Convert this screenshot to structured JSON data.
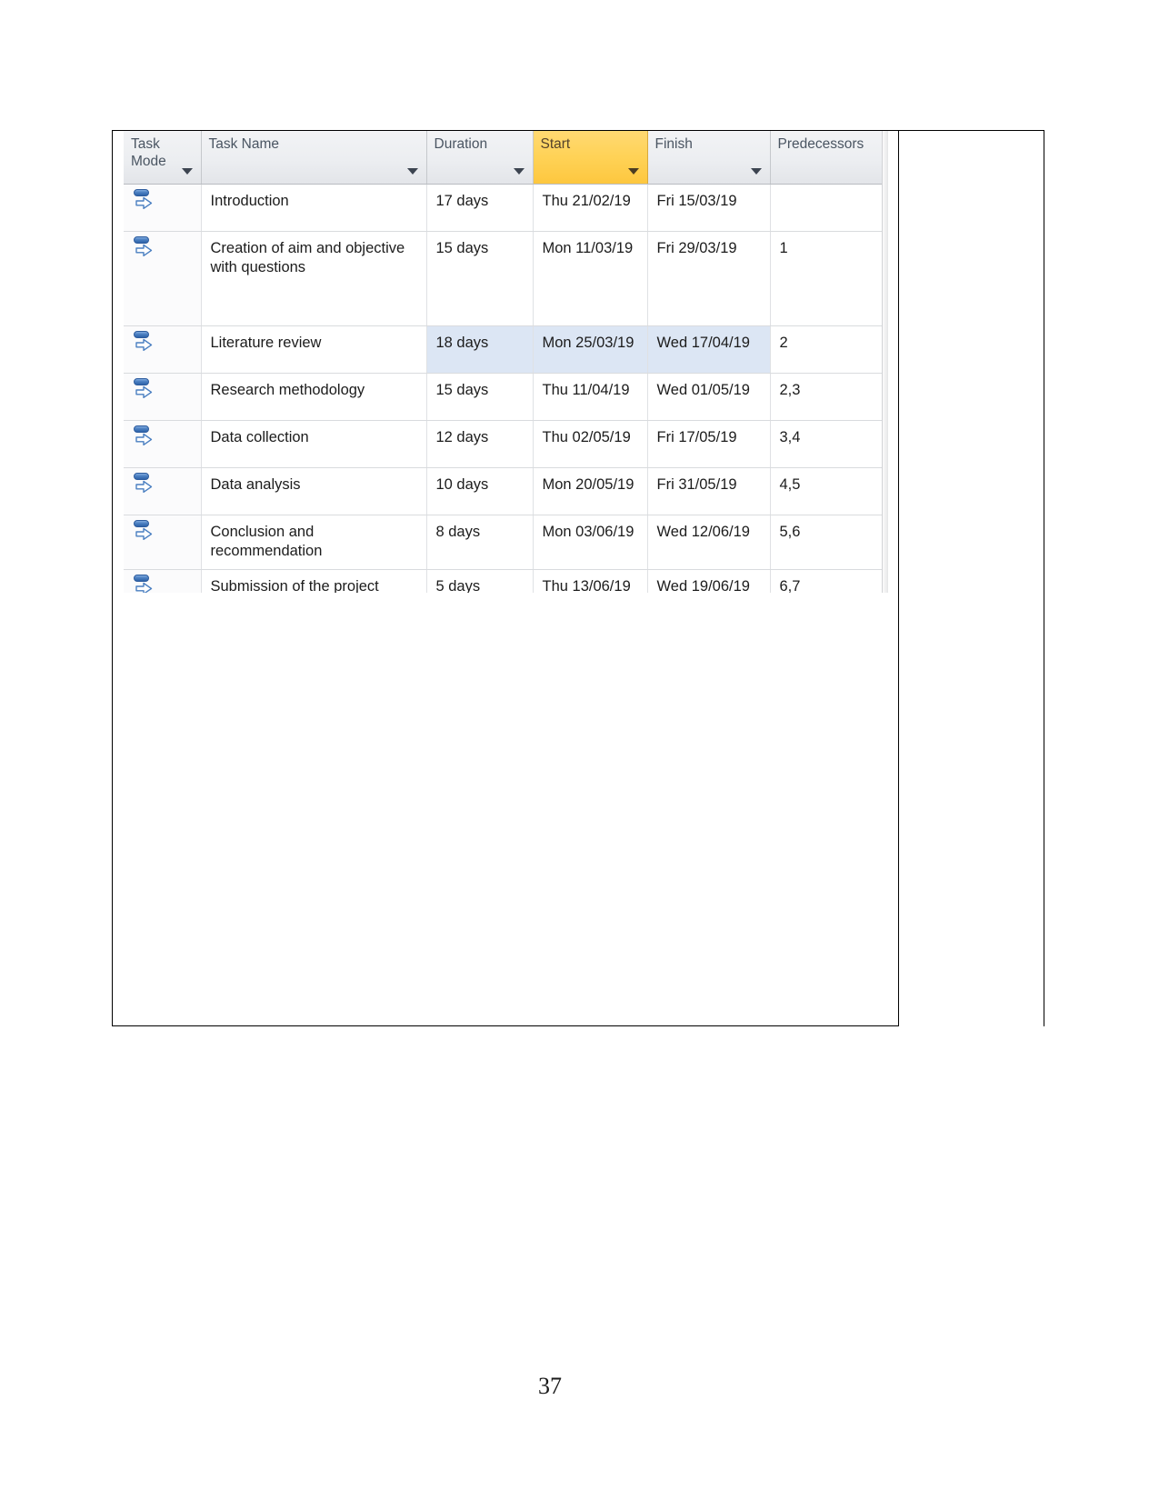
{
  "page": {
    "page_number": "37"
  },
  "project_table": {
    "columns": [
      {
        "id": "task_mode",
        "label": "Task Mode",
        "has_filter_caret": true,
        "highlighted": false
      },
      {
        "id": "task_name",
        "label": "Task Name",
        "has_filter_caret": true,
        "highlighted": false
      },
      {
        "id": "duration",
        "label": "Duration",
        "has_filter_caret": true,
        "highlighted": false
      },
      {
        "id": "start",
        "label": "Start",
        "has_filter_caret": true,
        "highlighted": true
      },
      {
        "id": "finish",
        "label": "Finish",
        "has_filter_caret": true,
        "highlighted": false
      },
      {
        "id": "predecessors",
        "label": "Predecessors",
        "has_filter_caret": false,
        "highlighted": false
      }
    ],
    "colors": {
      "header_background": "#eceef1",
      "header_text": "#4a5562",
      "start_header_background": "#ffd256",
      "start_header_text": "#53422a",
      "selection_background": "#dce6f4",
      "grid_line": "#d9dbde",
      "task_mode_icon": "#2f63a8"
    },
    "rows": [
      {
        "task_mode_icon": "manually-scheduled-icon",
        "task_name": "Introduction",
        "duration": "17 days",
        "start": "Thu 21/02/19",
        "finish": "Fri 15/03/19",
        "predecessors": "",
        "selected": false
      },
      {
        "task_mode_icon": "manually-scheduled-icon",
        "task_name": "Creation of aim and objective with questions",
        "duration": "15 days",
        "start": "Mon 11/03/19",
        "finish": "Fri 29/03/19",
        "predecessors": "1",
        "selected": false
      },
      {
        "task_mode_icon": "manually-scheduled-icon",
        "task_name": "Literature review",
        "duration": "18 days",
        "start": "Mon 25/03/19",
        "finish": "Wed 17/04/19",
        "predecessors": "2",
        "selected": true
      },
      {
        "task_mode_icon": "manually-scheduled-icon",
        "task_name": "Research methodology",
        "duration": "15 days",
        "start": "Thu 11/04/19",
        "finish": "Wed 01/05/19",
        "predecessors": "2,3",
        "selected": false
      },
      {
        "task_mode_icon": "manually-scheduled-icon",
        "task_name": "Data collection",
        "duration": "12 days",
        "start": "Thu 02/05/19",
        "finish": "Fri 17/05/19",
        "predecessors": "3,4",
        "selected": false
      },
      {
        "task_mode_icon": "manually-scheduled-icon",
        "task_name": "Data analysis",
        "duration": "10 days",
        "start": "Mon 20/05/19",
        "finish": "Fri 31/05/19",
        "predecessors": "4,5",
        "selected": false
      },
      {
        "task_mode_icon": "manually-scheduled-icon",
        "task_name": "Conclusion and recommendation",
        "duration": "8 days",
        "start": "Mon 03/06/19",
        "finish": "Wed 12/06/19",
        "predecessors": "5,6",
        "selected": false
      },
      {
        "task_mode_icon": "manually-scheduled-icon",
        "task_name": "Submission of the project",
        "duration": "5 days",
        "start": "Thu 13/06/19",
        "finish": "Wed 19/06/19",
        "predecessors": "6,7",
        "selected": false
      }
    ]
  }
}
